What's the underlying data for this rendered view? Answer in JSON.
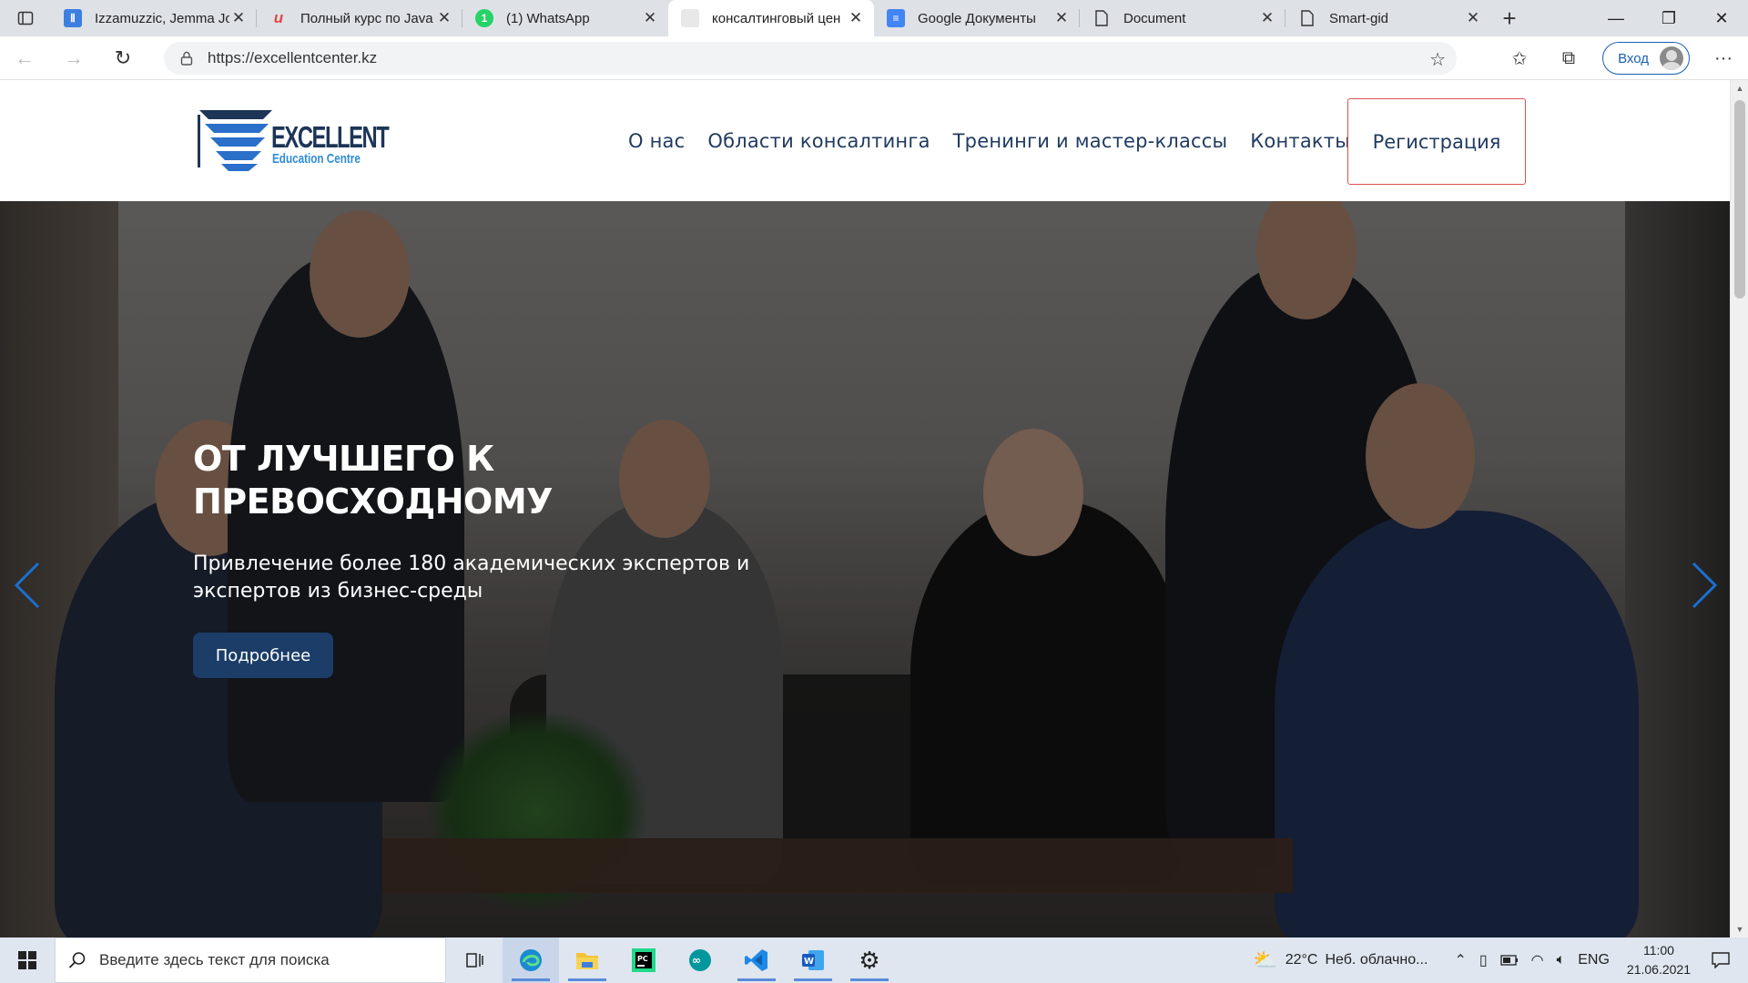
{
  "browser": {
    "tabs": [
      {
        "title": "Izzamuzzic, Jemma Jo",
        "icon": "izzamuzzic-favicon",
        "color": "#3d7fe0"
      },
      {
        "title": "Полный курс по Java",
        "icon": "course-favicon",
        "color": "#e04646"
      },
      {
        "title": "(1) WhatsApp",
        "icon": "whatsapp-favicon",
        "color": "#25d366",
        "badge": "1"
      },
      {
        "title": "консалтинговый цен",
        "icon": "page-favicon",
        "active": true
      },
      {
        "title": "Google Документы",
        "icon": "google-docs-favicon",
        "color": "#4285f4"
      },
      {
        "title": "Document",
        "icon": "document-favicon"
      },
      {
        "title": "Smart-gid",
        "icon": "document-favicon"
      }
    ],
    "url": "https://excellentcenter.kz",
    "signin_label": "Вход"
  },
  "site": {
    "logo": {
      "line1": "EXCELLENT",
      "line2": "Education Centre"
    },
    "menu": [
      "О нас",
      "Области консалтинга",
      "Тренинги и мастер-классы",
      "Контакты"
    ],
    "register_label": "Регистрация",
    "hero": {
      "title_line1": "ОТ ЛУЧШЕГО К",
      "title_line2": "ПРЕВОСХОДНОМУ",
      "subtitle": "Привлечение более 180 академических экспертов и экспертов из бизнес-среды",
      "button_label": "Подробнее"
    }
  },
  "taskbar": {
    "search_placeholder": "Введите здесь текст для поиска",
    "weather": {
      "temp": "22°C",
      "text": "Неб. облачно..."
    },
    "language": "ENG",
    "time": "11:00",
    "date": "21.06.2021"
  },
  "colors": {
    "brand_navy": "#1b3d68",
    "register_border": "#d9534f",
    "arrow_blue": "#1a6fd0"
  }
}
